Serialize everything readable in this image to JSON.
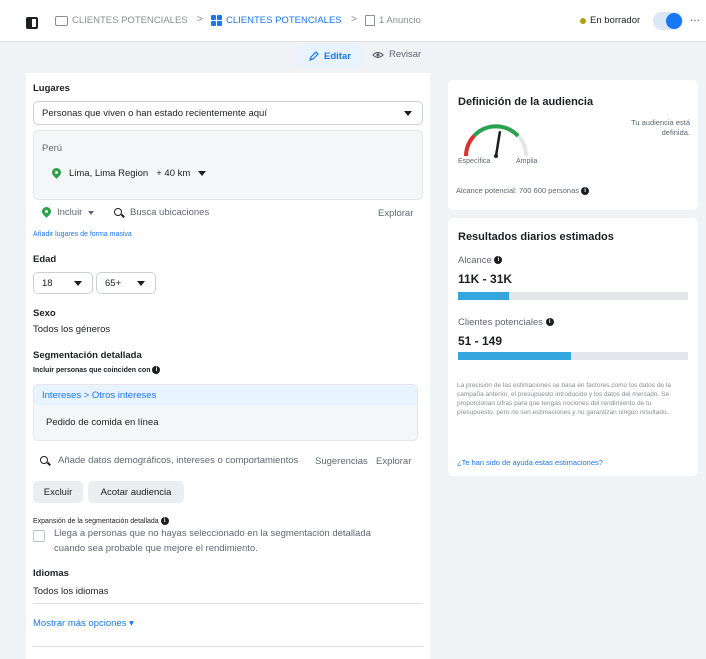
{
  "topbar": {
    "crumbs": [
      "CLIENTES POTENCIALES",
      "CLIENTES POTENCIALES",
      "1 Anuncio"
    ],
    "separator": ">",
    "status": "En borrador",
    "more": "..."
  },
  "actions": {
    "edit": "Editar",
    "review": "Revisar"
  },
  "locations": {
    "label": "Lugares",
    "mode_selected": "Personas que viven o han estado recientemente aquí",
    "country": "Perú",
    "location_name": "Lima, Lima Region",
    "radius": "+ 40 km",
    "include_label": "Incluir",
    "search_placeholder": "Busca ubicaciones",
    "explore": "Explorar",
    "bulk_link": "Añadir lugares de forma masiva"
  },
  "age": {
    "label": "Edad",
    "min": "18",
    "max": "65+"
  },
  "gender": {
    "label": "Sexo",
    "value": "Todos los géneros"
  },
  "detailed": {
    "label": "Segmentación detallada",
    "include_hint": "Incluir personas que coinciden con",
    "path": "Intereses > Otros intereses",
    "item": "Pedido de comida en línea",
    "search_placeholder": "Añade datos demográficos, intereses o comportamientos",
    "suggestions": "Sugerencias",
    "explore": "Explorar",
    "exclude": "Excluir",
    "narrow": "Acotar audiencia"
  },
  "expansion": {
    "label": "Expansión de la segmentación detallada",
    "text1": "Llega a personas que no hayas seleccionado en la segmentación detallada",
    "text2": "cuando sea probable que mejore el rendimiento."
  },
  "languages": {
    "label": "Idiomas",
    "value": "Todos los idiomas"
  },
  "more_options": "Mostrar más opciones ▾",
  "audience": {
    "title": "Definición de la audiencia",
    "status_text": "Tu audiencia está definida.",
    "specific": "Específica",
    "broad": "Amplia",
    "reach": "Alcance potencial: 700 600 personas",
    "gauge_level": 0.55
  },
  "daily": {
    "title": "Resultados diarios estimados",
    "reach_label": "Alcance",
    "reach_value": "11K - 31K",
    "reach_fraction": 0.22,
    "leads_label": "Clientes potenciales",
    "leads_value": "51 - 149",
    "leads_fraction": 0.49,
    "disclaimer": "La precisión de las estimaciones se basa en factores como los datos de la campaña anterior, el presupuesto introducido y los datos del mercado. Se proporcionan cifras para que tengas nociones del rendimiento de tu presupuesto, pero no son estimaciones y no garantizan ningún resultado.",
    "helpful": "¿Te han sido de ayuda estas estimaciones?"
  },
  "colors": {
    "accent": "#1877f2",
    "bar": "#34a7e0",
    "pin": "#2aa14b"
  }
}
